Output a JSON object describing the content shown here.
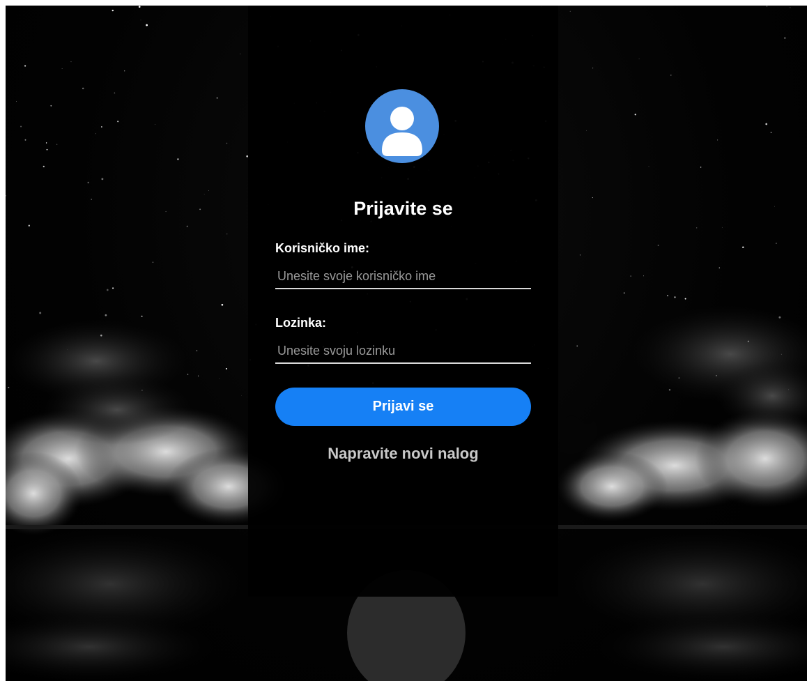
{
  "login": {
    "title": "Prijavite se",
    "username_label": "Korisničko ime:",
    "username_placeholder": "Unesite svoje korisničko ime",
    "password_label": "Lozinka:",
    "password_placeholder": "Unesite svoju lozinku",
    "submit_label": "Prijavi se",
    "register_link": "Napravite novi nalog"
  },
  "icons": {
    "avatar": "user-icon"
  },
  "colors": {
    "avatar_bg": "#4b8fe0",
    "button_bg": "#1680f5",
    "panel_bg": "#000000"
  }
}
